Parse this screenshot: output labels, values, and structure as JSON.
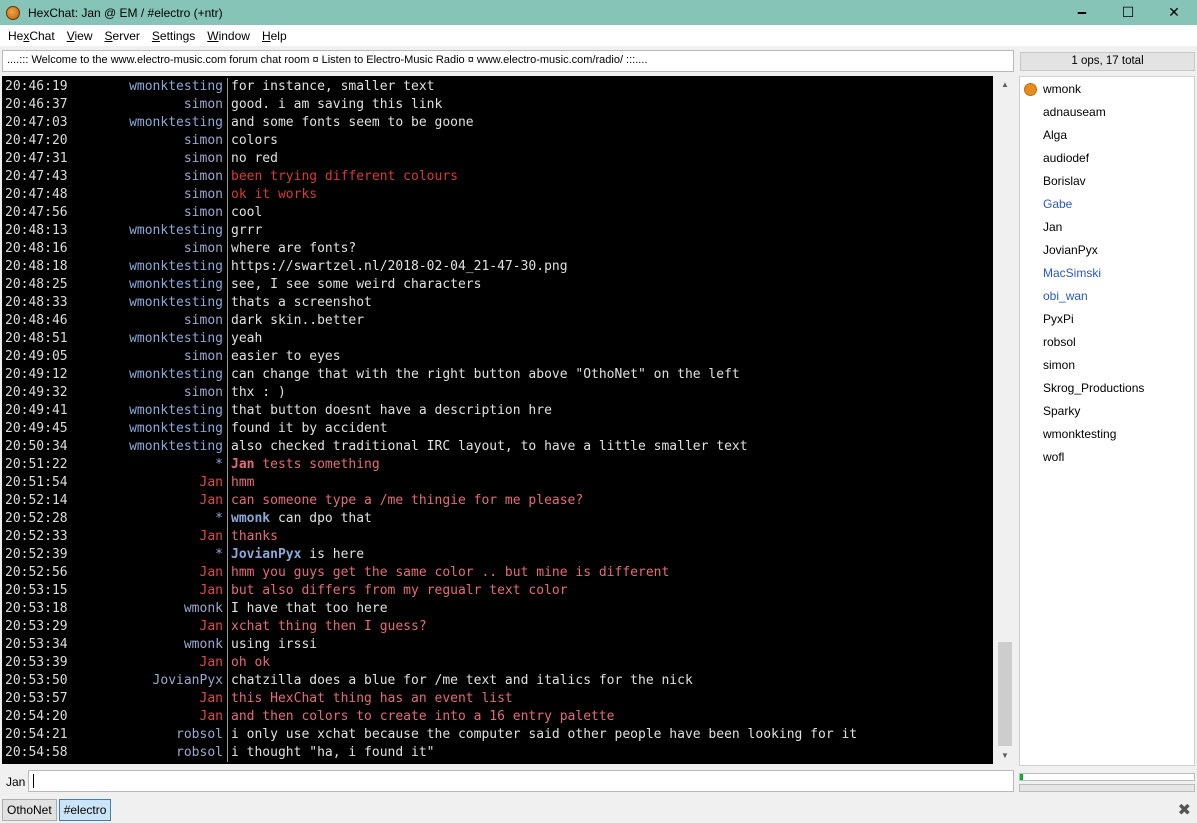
{
  "window": {
    "title": "HexChat: Jan @ EM / #electro (+ntr)",
    "minimize": "🗕",
    "maximize": "☐",
    "close": "✕"
  },
  "menu": {
    "hexchat": {
      "mn": "x",
      "pre": "He",
      "post": "Chat"
    },
    "view": {
      "mn": "V",
      "pre": "",
      "post": "iew"
    },
    "server": {
      "mn": "S",
      "pre": "",
      "post": "erver"
    },
    "settings": {
      "mn": "S",
      "pre": "",
      "post": "ettings"
    },
    "window": {
      "mn": "W",
      "pre": "",
      "post": "indow"
    },
    "help": {
      "mn": "H",
      "pre": "",
      "post": "elp"
    }
  },
  "topic": "....:::  Welcome to the www.electro-music.com forum chat room ¤ Listen to Electro-Music Radio ¤ www.electro-music.com/radio/  :::....",
  "user_count": "1 ops, 17 total",
  "chat": [
    {
      "time": "20:46:19",
      "nick": "wmonktesting",
      "text": "for instance, smaller text"
    },
    {
      "time": "20:46:37",
      "nick": "simon",
      "text": "good. i am saving this link"
    },
    {
      "time": "20:47:03",
      "nick": "wmonktesting",
      "text": "and some fonts seem to be goone"
    },
    {
      "time": "20:47:20",
      "nick": "simon",
      "text": "colors"
    },
    {
      "time": "20:47:31",
      "nick": "simon",
      "text": "no red"
    },
    {
      "time": "20:47:43",
      "nick": "simon",
      "text": "been trying different colours"
    },
    {
      "time": "20:47:48",
      "nick": "simon",
      "text": "ok it works"
    },
    {
      "time": "20:47:56",
      "nick": "simon",
      "text": "cool"
    },
    {
      "time": "20:48:13",
      "nick": "wmonktesting",
      "text": "grrr"
    },
    {
      "time": "20:48:16",
      "nick": "simon",
      "text": "where are fonts?"
    },
    {
      "time": "20:48:18",
      "nick": "wmonktesting",
      "text": "https://swartzel.nl/2018-02-04_21-47-30.png"
    },
    {
      "time": "20:48:25",
      "nick": "wmonktesting",
      "text": "see, I see some weird characters"
    },
    {
      "time": "20:48:33",
      "nick": "wmonktesting",
      "text": "thats a screenshot"
    },
    {
      "time": "20:48:46",
      "nick": "simon",
      "text": "dark skin..better"
    },
    {
      "time": "20:48:51",
      "nick": "wmonktesting",
      "text": "yeah"
    },
    {
      "time": "20:49:05",
      "nick": "simon",
      "text": "easier to eyes"
    },
    {
      "time": "20:49:12",
      "nick": "wmonktesting",
      "text": "can change that with the right button above \"OthoNet\" on the left"
    },
    {
      "time": "20:49:32",
      "nick": "simon",
      "text": "thx : )"
    },
    {
      "time": "20:49:41",
      "nick": "wmonktesting",
      "text": "that button doesnt have a description hre"
    },
    {
      "time": "20:49:45",
      "nick": "wmonktesting",
      "text": "found it by accident"
    },
    {
      "time": "20:50:34",
      "nick": "wmonktesting",
      "text": "also checked traditional IRC layout, to have a little smaller text"
    },
    {
      "time": "20:51:22",
      "nick": "*",
      "actor": "Jan",
      "text": "tests something"
    },
    {
      "time": "20:51:54",
      "nick": "Jan",
      "text": "hmm"
    },
    {
      "time": "20:52:14",
      "nick": "Jan",
      "text": "can someone type a /me thingie for me please?"
    },
    {
      "time": "20:52:28",
      "nick": "*",
      "actor": "wmonk",
      "text": "can dpo that"
    },
    {
      "time": "20:52:33",
      "nick": "Jan",
      "text": "thanks"
    },
    {
      "time": "20:52:39",
      "nick": "*",
      "actor": "JovianPyx",
      "text": "is here"
    },
    {
      "time": "20:52:56",
      "nick": "Jan",
      "text": "hmm you guys get the same color .. but mine is different"
    },
    {
      "time": "20:53:15",
      "nick": "Jan",
      "text": "but also differs from my regualr text color"
    },
    {
      "time": "20:53:18",
      "nick": "wmonk",
      "text": "I have that too here"
    },
    {
      "time": "20:53:29",
      "nick": "Jan",
      "text": "xchat thing then I guess?"
    },
    {
      "time": "20:53:34",
      "nick": "wmonk",
      "text": "using irssi"
    },
    {
      "time": "20:53:39",
      "nick": "Jan",
      "text": "oh ok"
    },
    {
      "time": "20:53:50",
      "nick": "JovianPyx",
      "text": "chatzilla does a blue for /me text and italics for the nick"
    },
    {
      "time": "20:53:57",
      "nick": "Jan",
      "text": "this HexChat thing has an event list"
    },
    {
      "time": "20:54:20",
      "nick": "Jan",
      "text": "and then colors to create into a 16 entry palette"
    },
    {
      "time": "20:54:21",
      "nick": "robsol",
      "text": "i only use xchat because the computer said other people have been looking for it"
    },
    {
      "time": "20:54:58",
      "nick": "robsol",
      "text": "i thought \"ha, i found it\""
    }
  ],
  "users": [
    {
      "name": "wmonk",
      "op": true,
      "away": false
    },
    {
      "name": "adnauseam",
      "op": false,
      "away": false
    },
    {
      "name": "Alga",
      "op": false,
      "away": false
    },
    {
      "name": "audiodef",
      "op": false,
      "away": false
    },
    {
      "name": "Borislav",
      "op": false,
      "away": false
    },
    {
      "name": "Gabe",
      "op": false,
      "away": true
    },
    {
      "name": "Jan",
      "op": false,
      "away": false
    },
    {
      "name": "JovianPyx",
      "op": false,
      "away": false
    },
    {
      "name": "MacSimski",
      "op": false,
      "away": true
    },
    {
      "name": "obi_wan",
      "op": false,
      "away": true
    },
    {
      "name": "PyxPi",
      "op": false,
      "away": false
    },
    {
      "name": "robsol",
      "op": false,
      "away": false
    },
    {
      "name": "simon",
      "op": false,
      "away": false
    },
    {
      "name": "Skrog_Productions",
      "op": false,
      "away": false
    },
    {
      "name": "Sparky",
      "op": false,
      "away": false
    },
    {
      "name": "wmonktesting",
      "op": false,
      "away": false
    },
    {
      "name": "wofl",
      "op": false,
      "away": false
    }
  ],
  "input": {
    "nick": "Jan",
    "value": ""
  },
  "tabs": [
    {
      "label": "OthoNet",
      "active": false
    },
    {
      "label": "#electro",
      "active": true
    }
  ],
  "lag_fraction": 0.02,
  "colors": {
    "titlebar": "#87c4b8",
    "chat_bg": "#000000",
    "nick_wmonktesting": "#8aa9d8",
    "nick_jan": "#e04848",
    "op_dot": "#e98c1e",
    "away_user": "#2a57c7"
  }
}
